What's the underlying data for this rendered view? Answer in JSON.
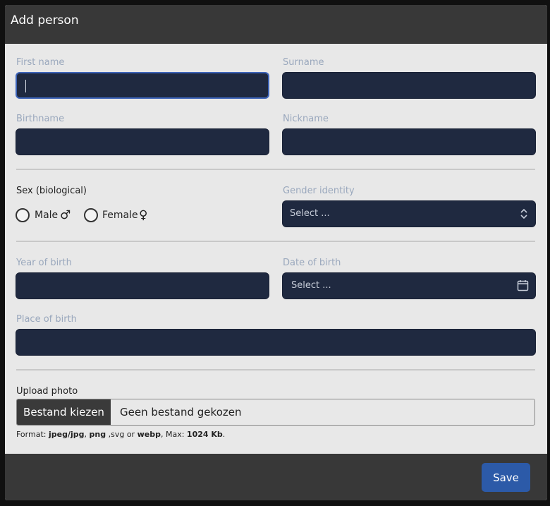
{
  "dialog": {
    "title": "Add person"
  },
  "fields": {
    "first_name": {
      "label": "First name",
      "value": ""
    },
    "surname": {
      "label": "Surname",
      "value": ""
    },
    "birthname": {
      "label": "Birthname",
      "value": ""
    },
    "nickname": {
      "label": "Nickname",
      "value": ""
    },
    "sex": {
      "label": "Sex (biological)",
      "options": [
        {
          "label": "Male",
          "symbol": "♂",
          "selected": false
        },
        {
          "label": "Female",
          "symbol": "♀",
          "selected": false
        }
      ]
    },
    "gender_identity": {
      "label": "Gender identity",
      "placeholder": "Select ..."
    },
    "year_of_birth": {
      "label": "Year of birth",
      "value": ""
    },
    "date_of_birth": {
      "label": "Date of birth",
      "placeholder": "Select ..."
    },
    "place_of_birth": {
      "label": "Place of birth",
      "value": ""
    }
  },
  "upload": {
    "label": "Upload photo",
    "button_label": "Bestand kiezen",
    "status": "Geen bestand gekozen",
    "format": {
      "prefix": "Format:",
      "types1": "jpeg/jpg",
      "sep1": ",",
      "types2": "png",
      "sep2": ",svg",
      "or": "or",
      "types3": "webp",
      "max_prefix": ", Max:",
      "max": "1024 Kb",
      "end": "."
    }
  },
  "footer": {
    "save_label": "Save"
  },
  "colors": {
    "input_bg": "#1f2940",
    "focus": "#3c63b8",
    "save": "#2c5aa8",
    "header": "#383838"
  },
  "icons": {
    "gender_select": "chevron-up-down-icon",
    "date_select": "calendar-icon"
  }
}
